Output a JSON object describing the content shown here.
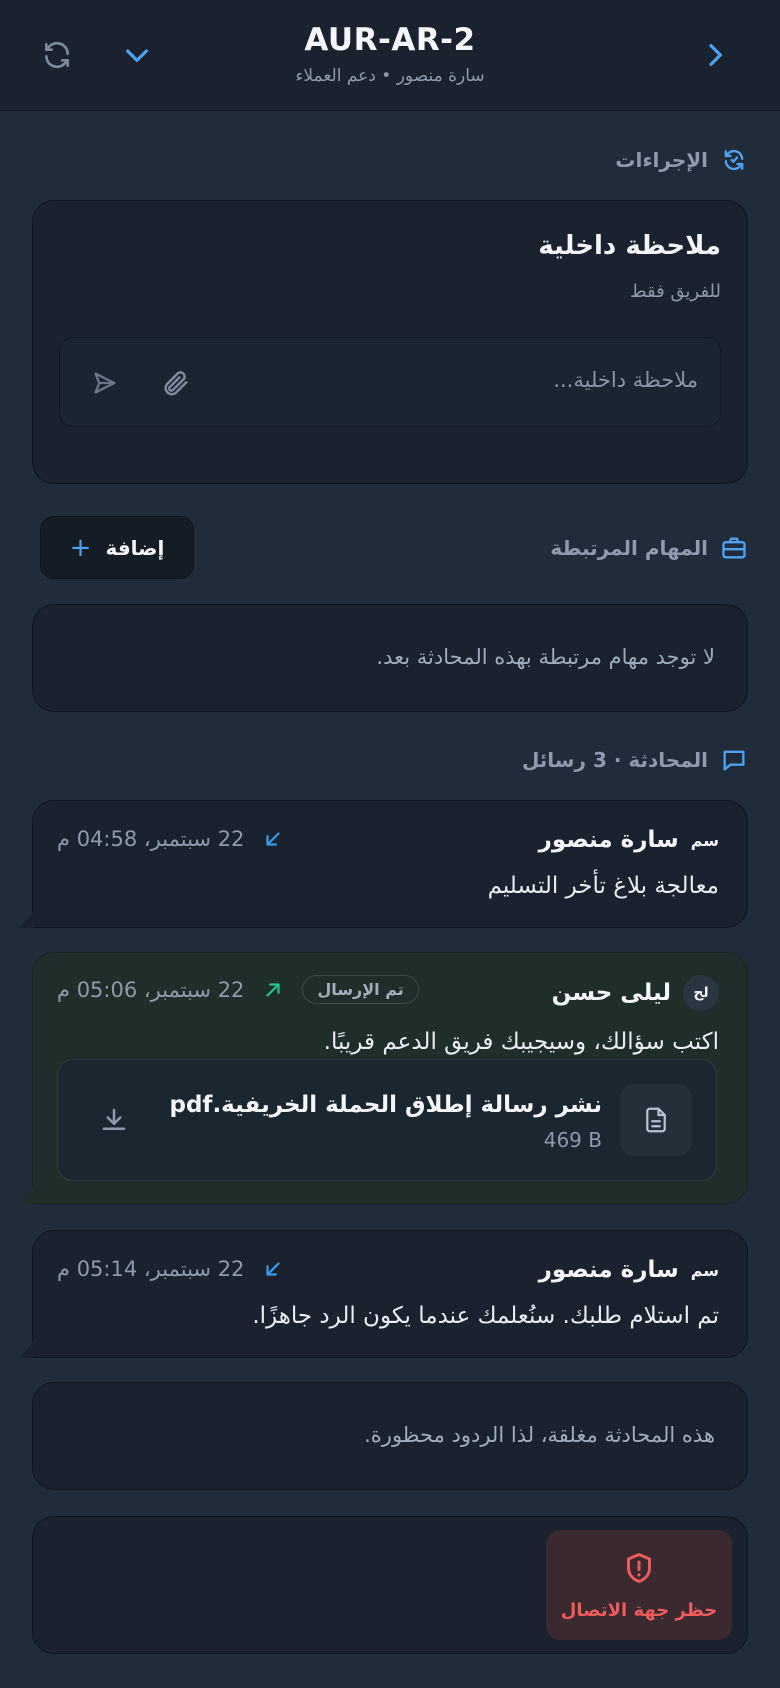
{
  "header": {
    "title": "AUR-AR-2",
    "subtitle": "سارة منصور • دعم العملاء",
    "icons": {
      "refresh": "refresh-icon",
      "collapse": "chevron-down-icon",
      "forward": "chevron-right-icon"
    }
  },
  "actions": {
    "heading": "الإجراءات",
    "icon": "sync-icon",
    "note": {
      "title": "ملاحظة داخلية",
      "subtitle": "للفريق فقط",
      "placeholder": "ملاحظة داخلية...",
      "value": ""
    }
  },
  "tasks": {
    "heading": "المهام المرتبطة",
    "icon": "briefcase-icon",
    "add_label": "إضافة",
    "empty": "لا توجد مهام مرتبطة بهذه المحادثة بعد."
  },
  "conversation": {
    "heading": "المحادثة · 3 رسائل",
    "icon": "chat-icon",
    "messages": [
      {
        "avatar": "سم",
        "sender": "سارة منصور",
        "time": "22 سبتمبر، 04:58 م",
        "direction": "incoming",
        "text": "معالجة بلاغ تأخر التسليم"
      },
      {
        "avatar": "لح",
        "sender": "ليلى حسن",
        "status": "تم الإرسال",
        "time": "22 سبتمبر، 05:06 م",
        "direction": "outgoing",
        "text": "اكتب سؤالك، وسيجيبك فريق الدعم قريبًا.",
        "attachment": {
          "name": "نشر رسالة إطلاق الحملة الخريفية.pdf",
          "size": "469 B"
        }
      },
      {
        "avatar": "سم",
        "sender": "سارة منصور",
        "time": "22 سبتمبر، 05:14 م",
        "direction": "incoming",
        "text": "تم استلام طلبك. سنُعلمك عندما يكون الرد جاهزًا."
      }
    ],
    "closed_notice": "هذه المحادثة مغلقة، لذا الردود محظورة."
  },
  "block": {
    "label": "حظر جهة الاتصال",
    "icon": "shield-alert-icon"
  },
  "colors": {
    "accent": "#4ea2f2",
    "danger": "#ee5b5b",
    "sent_arrow": "#23c48a",
    "bg": "#212c3a",
    "card": "#19222e"
  }
}
